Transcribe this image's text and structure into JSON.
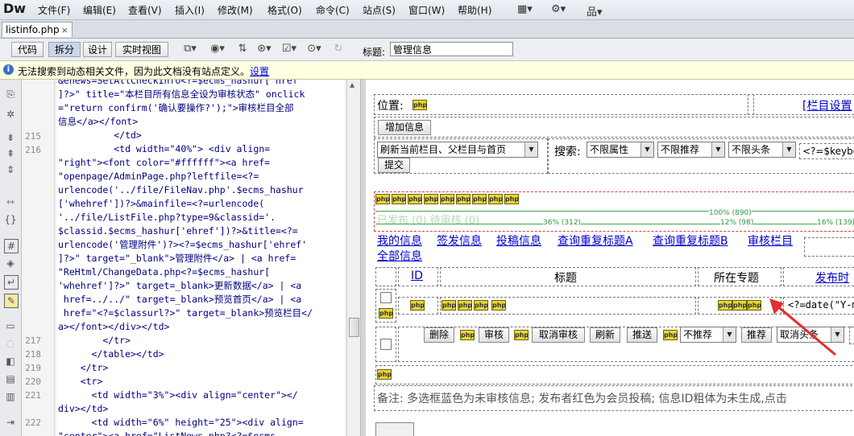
{
  "app": {
    "logo": "Dw"
  },
  "menu": [
    "文件(F)",
    "编辑(E)",
    "查看(V)",
    "插入(I)",
    "修改(M)",
    "格式(O)",
    "命令(C)",
    "站点(S)",
    "窗口(W)",
    "帮助(H)"
  ],
  "document_tab": {
    "name": "listinfo.php",
    "close": "×"
  },
  "toolbar": {
    "views": [
      "代码",
      "拆分",
      "设计",
      "实时视图"
    ],
    "title_label": "标题:",
    "title_value": "管理信息"
  },
  "infobar": {
    "message": "无法搜索到动态相关文件，因为此文档没有站点定义。",
    "link": "设置"
  },
  "code": {
    "line_numbers": [
      "215",
      "216",
      "217",
      "218",
      "219",
      "220",
      "221",
      "222"
    ],
    "lines": [
      "&enews=SetAllCheckInfo<?=$ecms_hashur['href",
      "]?>\" title=\"本栏目所有信息全设为审核状态\" onclick",
      "=\"return confirm('确认要操作?');\">审核栏目全部",
      "信息</a></font>",
      "          </td>",
      "          <td width=\"40%\"> <div align=",
      "\"right\"><font color=\"#ffffff\"><a href=",
      "\"openpage/AdminPage.php?leftfile=<?=",
      "urlencode('../file/FileNav.php'.$ecms_hashur",
      "['whehref'])?>&mainfile=<?=urlencode(",
      "'../file/ListFile.php?type=9&classid='.",
      "$classid.$ecms_hashur['ehref'])?>&title=<?=",
      "urlencode('管理附件')?><?=$ecms_hashur['ehref'",
      "]?>\" target=\"_blank\">管理附件</a> | <a href=",
      "\"ReHtml/ChangeData.php<?=$ecms_hashur[",
      "'whehref']?>\" target=_blank>更新数据</a> | <a",
      " href=../../\" target=_blank>预览首页</a> | <a",
      " href=\"<?=$classurl?>\" target=_blank>预览栏目</",
      "a></font></div></td>",
      "        </tr>",
      "      </table></td>",
      "    </tr>",
      "    <tr>",
      "      <td width=\"3%\"><div align=\"center\"></",
      "div></td>",
      "      <td width=\"6%\" height=\"25\"><div align=",
      "\"center\"><a href=\"ListNews.php?<?=$ecms_"
    ]
  },
  "design": {
    "position_label": "位置:",
    "column_settings": "[栏目设置",
    "add_info": "增加信息",
    "refresh_select": "刷新当前栏目、父栏目与首页",
    "search_label": "搜索:",
    "filter_attr": "不限属性",
    "filter_recommend": "不限推荐",
    "filter_headline": "不限头条",
    "keyboard_var": "<?=$keybo",
    "submit": "提交",
    "faded_tabs": "已发布 (0) 待审核 (0)",
    "ruler_pct_100": "100% (890)",
    "ruler_pct_36": "36% (312)",
    "ruler_pct_12": "12% (98)",
    "ruler_pct_16": "16% (139)",
    "links": [
      "我的信息",
      "签发信息",
      "投稿信息",
      "查询重复标题A",
      "查询重复标题B",
      "审核栏目"
    ],
    "all_info": "全部信息",
    "col_id": "ID",
    "col_title": "标题",
    "col_topic": "所在专题",
    "col_publish": "发布时",
    "date_expr": "<?=date(\"Y-m",
    "php_badge": "php",
    "actions": {
      "delete": "删除",
      "audit": "审核",
      "cancel_audit": "取消审核",
      "refresh": "刷新",
      "push": "推送",
      "no_recommend": "不推荐",
      "recommend": "推荐",
      "cancel_headline": "取消头条"
    },
    "footnote": "备注: 多选框蓝色为未审核信息; 发布者红色为会员投稿; 信息ID粗体为未生成,点击"
  }
}
